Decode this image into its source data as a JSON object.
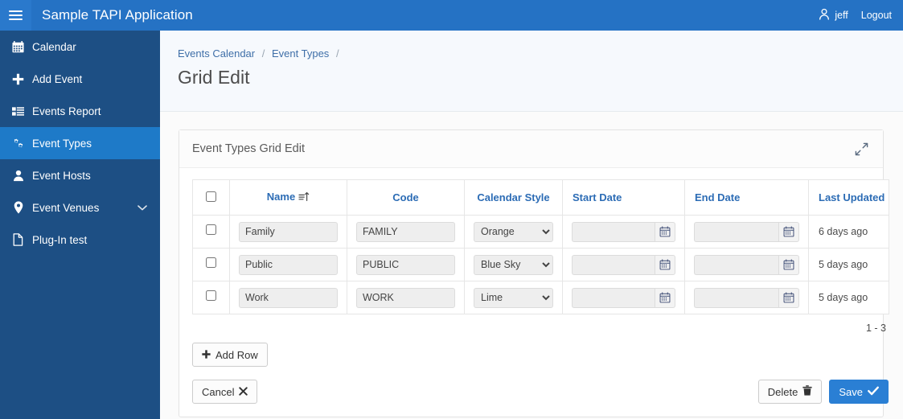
{
  "topbar": {
    "menu_icon": "hamburger-icon",
    "brand": "Sample TAPI Application",
    "user_icon": "user-icon",
    "username": "jeff",
    "logout": "Logout"
  },
  "sidebar": {
    "items": [
      {
        "label": "Calendar",
        "icon": "calendar-icon",
        "active": false,
        "caret": false
      },
      {
        "label": "Add Event",
        "icon": "plus-icon",
        "active": false,
        "caret": false
      },
      {
        "label": "Events Report",
        "icon": "list-icon",
        "active": false,
        "caret": false
      },
      {
        "label": "Event Types",
        "icon": "gears-icon",
        "active": true,
        "caret": false
      },
      {
        "label": "Event Hosts",
        "icon": "user-solid-icon",
        "active": false,
        "caret": false
      },
      {
        "label": "Event Venues",
        "icon": "map-pin-icon",
        "active": false,
        "caret": true
      },
      {
        "label": "Plug-In test",
        "icon": "file-icon",
        "active": false,
        "caret": false
      }
    ]
  },
  "breadcrumb": {
    "items": [
      "Events Calendar",
      "Event Types"
    ],
    "separator": "/",
    "trailing_separator": "/"
  },
  "page": {
    "title": "Grid Edit"
  },
  "panel": {
    "title": "Event Types Grid Edit",
    "expand_icon": "expand-arrows-icon"
  },
  "table": {
    "headers": {
      "select_all": "",
      "name": "Name",
      "code": "Code",
      "calendar_style": "Calendar Style",
      "start_date": "Start Date",
      "end_date": "End Date",
      "last_updated": "Last Updated"
    },
    "sort": {
      "column": "Name",
      "direction": "ascending",
      "icon": "sort-ascending-icon"
    },
    "date_picker_icon": "calendar-picker-icon",
    "style_options": [
      "Orange",
      "Blue Sky",
      "Lime"
    ],
    "rows": [
      {
        "checked": false,
        "name": "Family",
        "code": "FAMILY",
        "calendar_style": "Orange",
        "start_date": "",
        "end_date": "",
        "last_updated": "6 days ago"
      },
      {
        "checked": false,
        "name": "Public",
        "code": "PUBLIC",
        "calendar_style": "Blue Sky",
        "start_date": "",
        "end_date": "",
        "last_updated": "5 days ago"
      },
      {
        "checked": false,
        "name": "Work",
        "code": "WORK",
        "calendar_style": "Lime",
        "start_date": "",
        "end_date": "",
        "last_updated": "5 days ago"
      }
    ]
  },
  "pager": {
    "range": "1 - 3"
  },
  "buttons": {
    "add_row": "Add Row",
    "add_row_icon": "plus-icon",
    "cancel": "Cancel",
    "cancel_icon": "x-icon",
    "delete": "Delete",
    "delete_icon": "trash-icon",
    "save": "Save",
    "save_icon": "check-icon"
  },
  "colors": {
    "topbar_blue": "#2572c4",
    "sidebar_blue": "#1d4f84",
    "sidebar_active": "#1e7ac8",
    "link_blue": "#2c6cb5",
    "primary_button": "#2a7fd4",
    "page_head_bg": "#f6f9fd"
  }
}
